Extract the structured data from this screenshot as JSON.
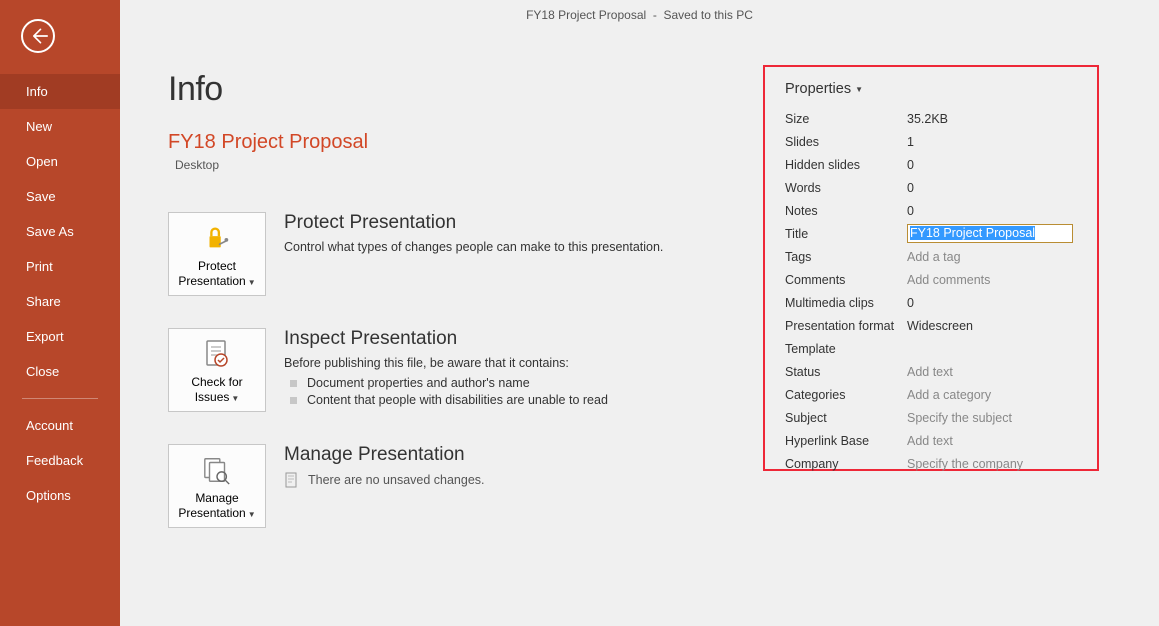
{
  "titlebar": {
    "filename": "FY18 Project Proposal",
    "saved_status": "Saved to this PC"
  },
  "sidebar": {
    "items": [
      {
        "id": "info",
        "label": "Info",
        "active": true
      },
      {
        "id": "new",
        "label": "New"
      },
      {
        "id": "open",
        "label": "Open"
      },
      {
        "id": "save",
        "label": "Save"
      },
      {
        "id": "saveas",
        "label": "Save As"
      },
      {
        "id": "print",
        "label": "Print"
      },
      {
        "id": "share",
        "label": "Share"
      },
      {
        "id": "export",
        "label": "Export"
      },
      {
        "id": "close",
        "label": "Close"
      }
    ],
    "footer_items": [
      {
        "id": "account",
        "label": "Account"
      },
      {
        "id": "feedback",
        "label": "Feedback"
      },
      {
        "id": "options",
        "label": "Options"
      }
    ]
  },
  "page": {
    "heading": "Info",
    "file_title": "FY18 Project Proposal",
    "file_location": "Desktop"
  },
  "sections": {
    "protect": {
      "button": "Protect Presentation",
      "heading": "Protect Presentation",
      "desc": "Control what types of changes people can make to this presentation."
    },
    "inspect": {
      "button": "Check for Issues",
      "heading": "Inspect Presentation",
      "desc": "Before publishing this file, be aware that it contains:",
      "items": [
        "Document properties and author's name",
        "Content that people with disabilities are unable to read"
      ]
    },
    "manage": {
      "button": "Manage Presentation",
      "heading": "Manage Presentation",
      "unsaved": "There are no unsaved changes."
    }
  },
  "properties": {
    "header": "Properties",
    "rows": [
      {
        "label": "Size",
        "value": "35.2KB"
      },
      {
        "label": "Slides",
        "value": "1"
      },
      {
        "label": "Hidden slides",
        "value": "0"
      },
      {
        "label": "Words",
        "value": "0"
      },
      {
        "label": "Notes",
        "value": "0"
      },
      {
        "label": "Title",
        "value": "FY18 Project Proposal",
        "editable": true
      },
      {
        "label": "Tags",
        "value": "Add a tag",
        "placeholder": true
      },
      {
        "label": "Comments",
        "value": "Add comments",
        "placeholder": true
      },
      {
        "label": "Multimedia clips",
        "value": "0"
      },
      {
        "label": "Presentation format",
        "value": "Widescreen"
      },
      {
        "label": "Template",
        "value": ""
      },
      {
        "label": "Status",
        "value": "Add text",
        "placeholder": true
      },
      {
        "label": "Categories",
        "value": "Add a category",
        "placeholder": true
      },
      {
        "label": "Subject",
        "value": "Specify the subject",
        "placeholder": true
      },
      {
        "label": "Hyperlink Base",
        "value": "Add text",
        "placeholder": true
      },
      {
        "label": "Company",
        "value": "Specify the company",
        "placeholder": true
      }
    ]
  }
}
